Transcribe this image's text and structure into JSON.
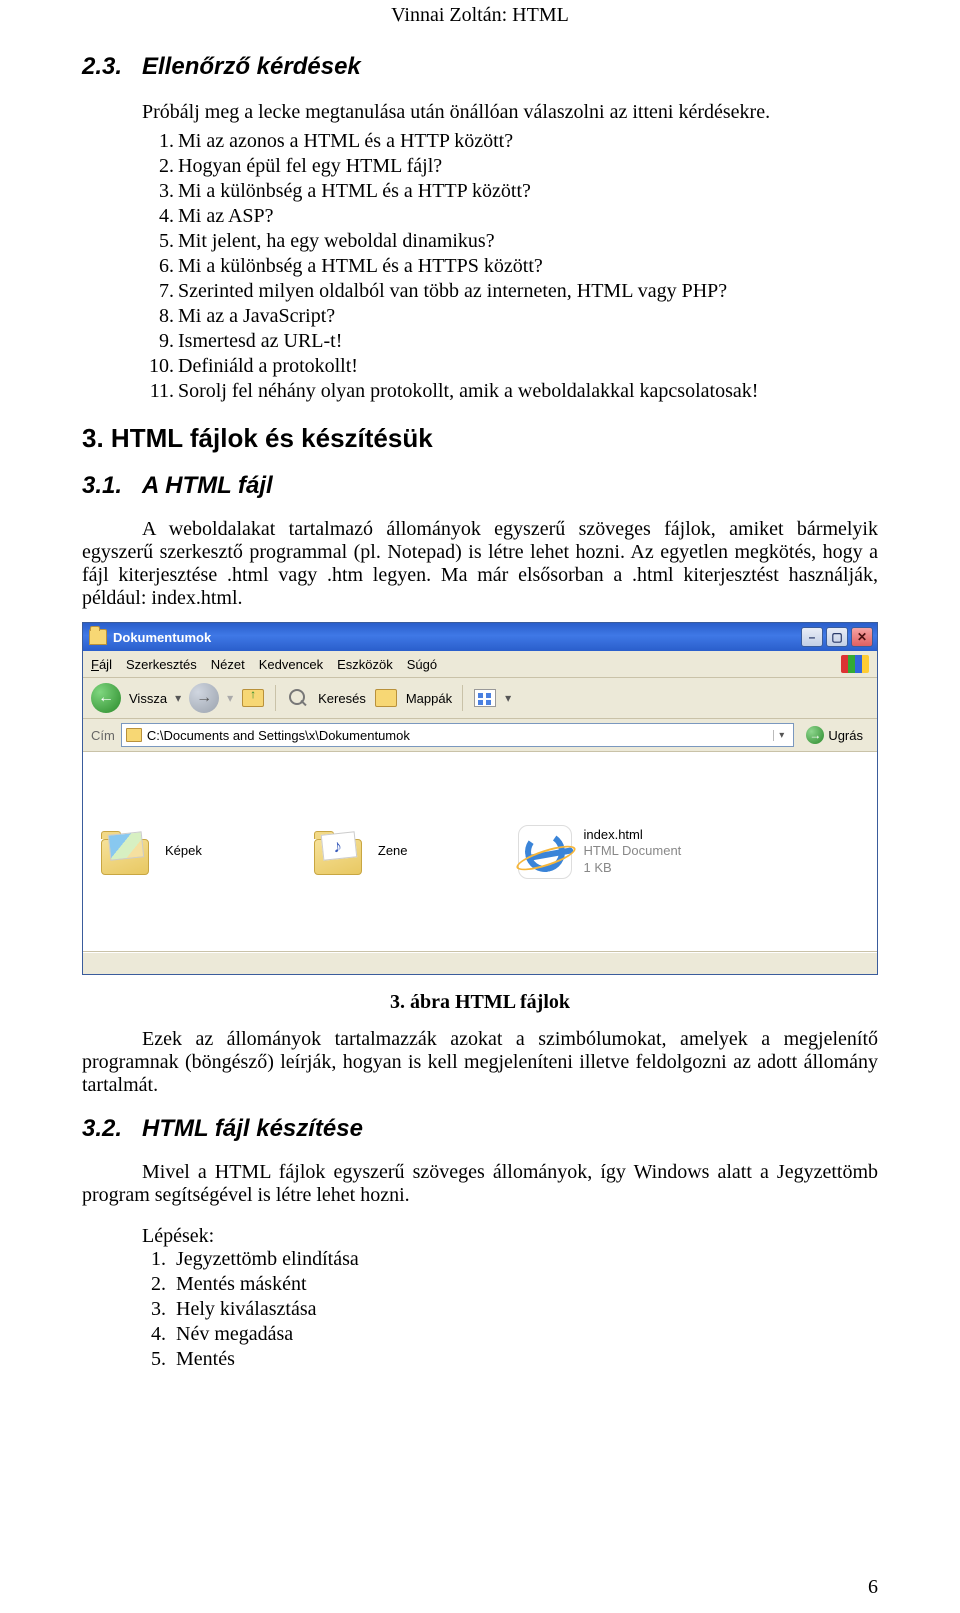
{
  "header": {
    "author": "Vinnai Zoltán: HTML"
  },
  "s23": {
    "num": "2.3.",
    "title": "Ellenőrző kérdések",
    "intro": "Próbálj meg a lecke megtanulása után önállóan válaszolni az itteni kérdésekre.",
    "items": [
      "Mi az azonos a HTML és a HTTP között?",
      "Hogyan épül fel egy HTML fájl?",
      "Mi a különbség a HTML és a HTTP között?",
      "Mi az ASP?",
      "Mit jelent, ha egy weboldal dinamikus?",
      "Mi a különbség a HTML és a HTTPS között?",
      "Szerinted milyen oldalból van több az interneten, HTML vagy PHP?",
      "Mi az a JavaScript?",
      "Ismertesd az URL-t!",
      "Definiáld a protokollt!",
      "Sorolj fel néhány olyan protokollt, amik a weboldalakkal kapcsolatosak!"
    ]
  },
  "s3": {
    "num": "3.",
    "title": "HTML fájlok és készítésük"
  },
  "s31": {
    "num": "3.1.",
    "title": "A HTML fájl",
    "para": "A weboldalakat tartalmazó állományok egyszerű szöveges fájlok, amiket bármelyik egyszerű szerkesztő programmal (pl. Notepad) is létre lehet hozni. Az egyetlen megkötés, hogy a fájl kiterjesztése .html vagy .htm legyen. Ma már elsősorban a .html kiterjesztést használják, például: index.html."
  },
  "xp": {
    "title": "Dokumentumok",
    "menu": {
      "file": "Fájl",
      "edit": "Szerkesztés",
      "view": "Nézet",
      "fav": "Kedvencek",
      "tools": "Eszközök",
      "help": "Súgó"
    },
    "toolbar": {
      "back": "Vissza",
      "search": "Keresés",
      "folders": "Mappák"
    },
    "addr": {
      "label": "Cím",
      "path": "C:\\Documents and Settings\\x\\Dokumentumok",
      "go": "Ugrás"
    },
    "items": {
      "pics": {
        "label": "Képek"
      },
      "music": {
        "label": "Zene"
      },
      "index": {
        "name": "index.html",
        "type": "HTML Document",
        "size": "1 KB"
      }
    }
  },
  "caption": "3. ábra HTML fájlok",
  "para2": "Ezek az állományok tartalmazzák azokat a szimbólumokat, amelyek a megjelenítő programnak (böngésző) leírják, hogyan is kell megjeleníteni illetve feldolgozni az adott állomány tartalmát.",
  "s32": {
    "num": "3.2.",
    "title": "HTML fájl készítése",
    "para": "Mivel a HTML fájlok egyszerű szöveges állományok, így Windows alatt a Jegyzettömb program segítségével is létre lehet hozni.",
    "steps_label": "Lépések:",
    "steps": [
      "Jegyzettömb elindítása",
      "Mentés másként",
      "Hely kiválasztása",
      "Név megadása",
      "Mentés"
    ]
  },
  "page": "6"
}
